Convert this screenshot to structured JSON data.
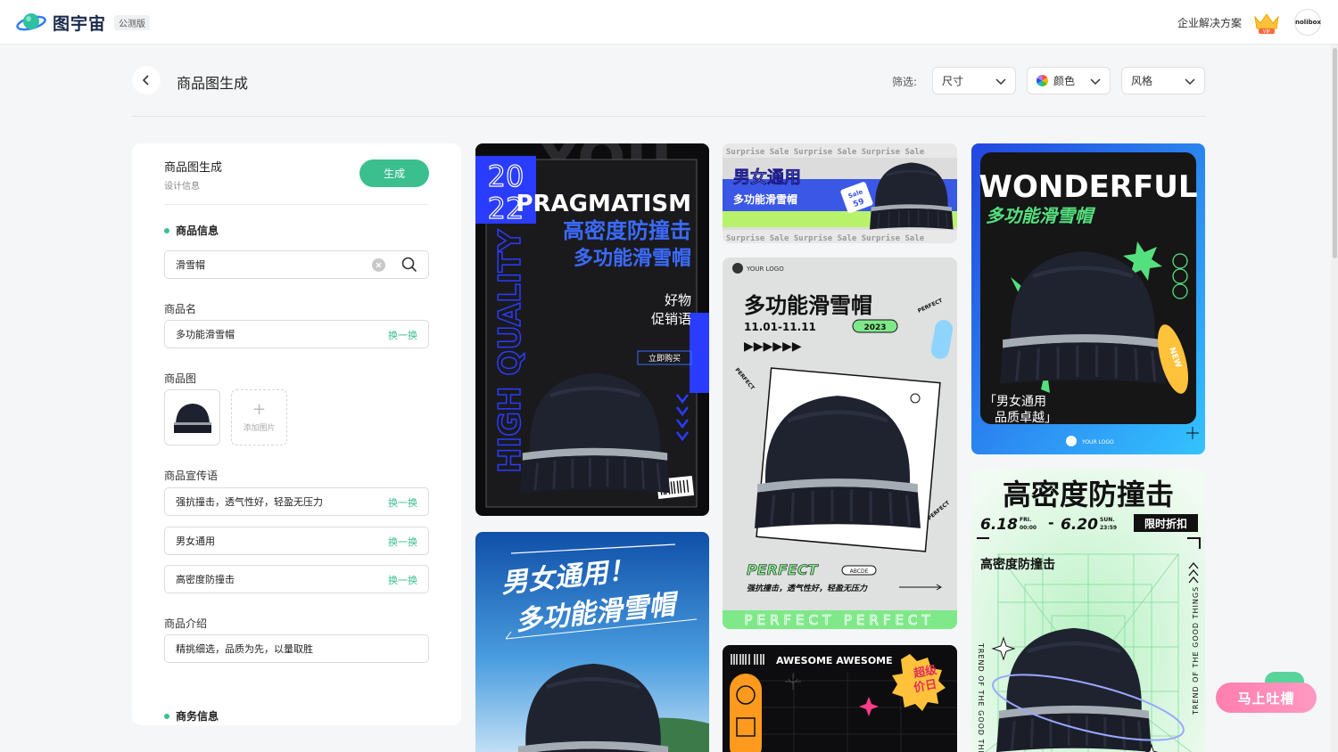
{
  "app": {
    "name": "图宇宙",
    "badge": "公测版",
    "enterprise_link": "企业解决方案",
    "vip_label": "VIP",
    "avatar_text": "nolibox"
  },
  "header": {
    "title": "商品图生成",
    "filter_label": "筛选:",
    "filters": {
      "size": "尺寸",
      "color": "颜色",
      "style": "风格"
    }
  },
  "panel": {
    "title": "商品图生成",
    "subtitle": "设计信息",
    "generate_label": "生成",
    "product_section": "商品信息",
    "search_value": "滑雪帽",
    "name_label": "商品名",
    "name_value": "多功能滑雪帽",
    "swap_label": "换一换",
    "image_label": "商品图",
    "add_image_label": "添加图片",
    "slogan_label": "商品宣传语",
    "slogans": [
      "强抗撞击，透气性好，轻盈无压力",
      "男女通用",
      "高密度防撞击"
    ],
    "intro_label": "商品介绍",
    "intro_value": "精挑细选，品质为先，以量取胜",
    "business_section": "商务信息"
  },
  "cards": {
    "c1": {
      "year_top": "20",
      "year_bottom": "22",
      "headline": "PRAGMATISM",
      "line1": "高密度防撞击",
      "line2": "多功能滑雪帽",
      "promo1": "好物",
      "promo2": "促销语",
      "buy": "立即购买",
      "side": "HIGH QUALITY",
      "big": "YOU"
    },
    "c2": {
      "band": "Surprise Sale Surprise Sale Surprise Sale",
      "title": "男女通用",
      "sub": "多功能滑雪帽",
      "tag_top": "Sale",
      "tag_num": "59"
    },
    "c3": {
      "logo": "YOUR LOGO",
      "title": "多功能滑雪帽",
      "date": "11.01-11.11",
      "year": "2023",
      "arrows": "▶▶▶▶▶▶",
      "tag": "PERFECT",
      "brand": "PERFECT",
      "abcde": "ABCDE",
      "slogan": "强抗撞击，透气性好，轻盈无压力",
      "footer": "PERFECT PERFECT"
    },
    "c4": {
      "title": "WONDERFUL",
      "sub": "多功能滑雪帽",
      "q1": "「男女通用",
      "q2": "品质卓越」",
      "badge": "NEW",
      "logo": "YOUR LOGO"
    },
    "c5": {
      "line1": "男女通用！",
      "line2": "多功能滑雪帽"
    },
    "c6": {
      "awesome": "AWESOME AWESOME",
      "badge1": "超级",
      "badge2": "价日"
    },
    "c7": {
      "title": "高密度防撞击",
      "date1": "6.18",
      "day1": "FRI.",
      "time1": "00:00",
      "dash": "-",
      "date2": "6.20",
      "day2": "SUN.",
      "time2": "23:59",
      "tag": "限时折扣",
      "sub": "高密度防撞击",
      "side1": "TREND OF THE GOOD THINGS",
      "side2": "TREND OF THE GOOD THINGS"
    }
  },
  "feedback": {
    "label": "马上吐槽"
  },
  "colors": {
    "accent": "#3bbf8f",
    "pink": "#ff8fbb",
    "blue": "#2a3cff",
    "lime": "#55e07e"
  }
}
